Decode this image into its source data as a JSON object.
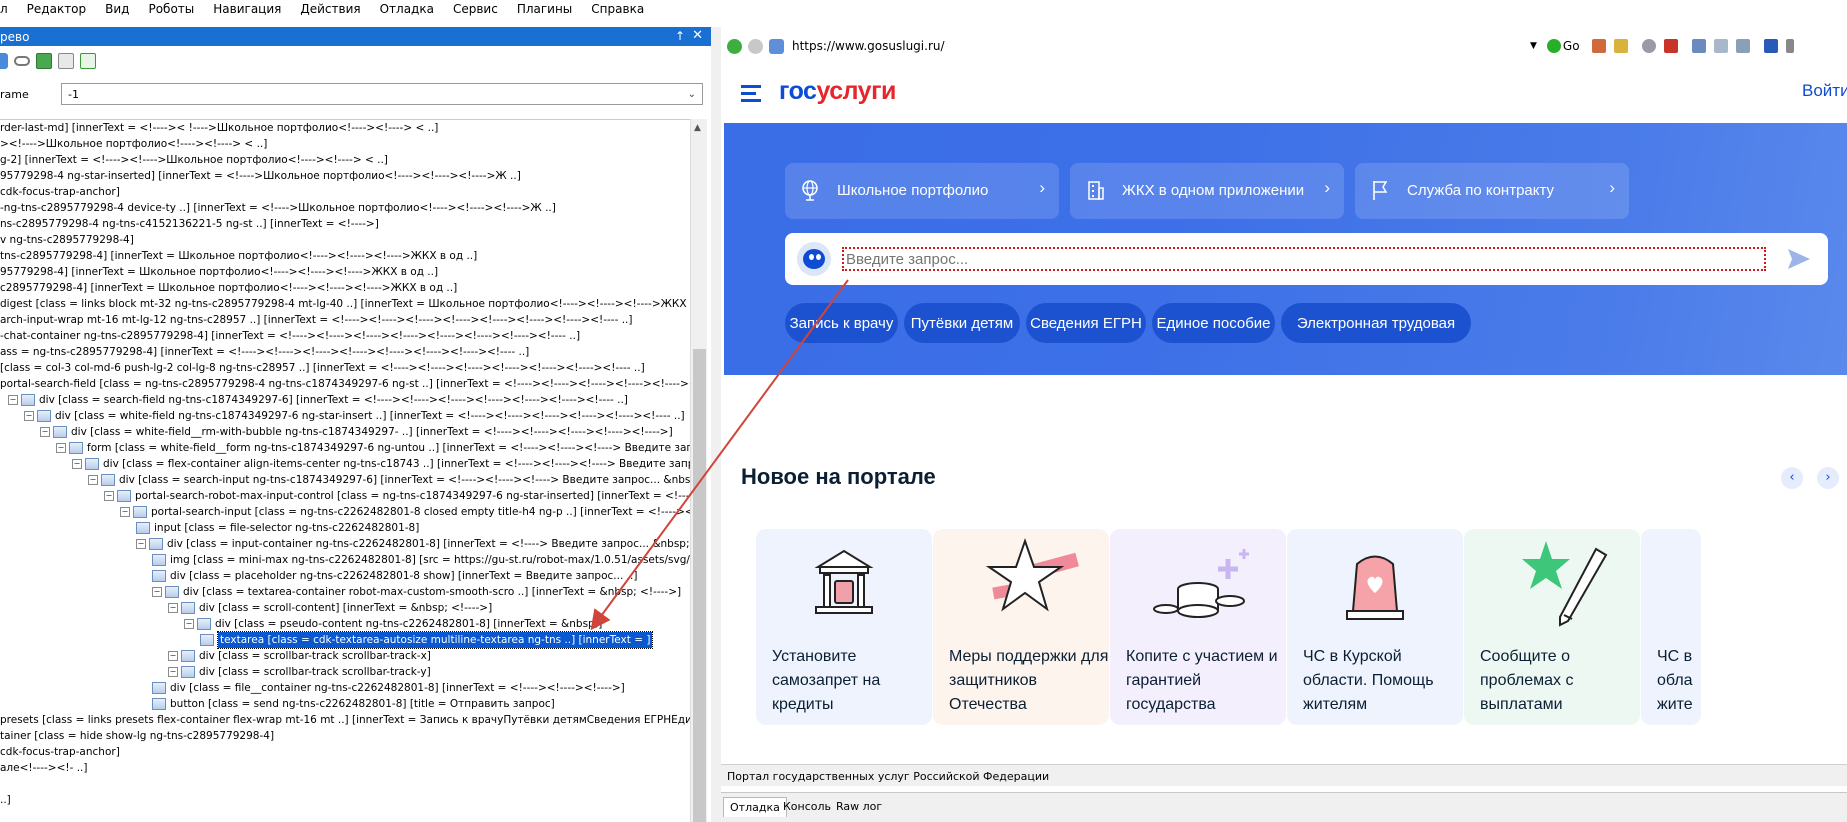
{
  "menu": [
    "л",
    "Редактор",
    "Вид",
    "Роботы",
    "Навигация",
    "Действия",
    "Отладка",
    "Сервис",
    "Плагины",
    "Справка"
  ],
  "panel": {
    "title": "рево",
    "pin": "↑",
    "close": "✕"
  },
  "frame": {
    "label": "rame",
    "value": "-1"
  },
  "tree": [
    {
      "indent": 0,
      "text": "rder-last-md] [innerText = <!---->< !---->Школьное портфолио<!----><!----> < ..]"
    },
    {
      "indent": 0,
      "text": "><!---->Школьное портфолио<!----><!----> < ..]"
    },
    {
      "indent": 0,
      "text": "g-2] [innerText = <!----><!---->Школьное портфолио<!----><!----> < ..]"
    },
    {
      "indent": 0,
      "text": "95779298-4 ng-star-inserted] [innerText = <!---->Школьное портфолио<!----><!----><!---->Ж ..]"
    },
    {
      "indent": 0,
      "text": " cdk-focus-trap-anchor]"
    },
    {
      "indent": 0,
      "text": "-ng-tns-c2895779298-4 device-ty ..] [innerText = <!---->Школьное портфолио<!----><!----><!---->Ж ..]"
    },
    {
      "indent": 0,
      "text": "ns-c2895779298-4 ng-tns-c4152136221-5 ng-st ..] [innerText = <!---->]"
    },
    {
      "indent": 0,
      "text": "v ng-tns-c2895779298-4]"
    },
    {
      "indent": 0,
      "text": "tns-c2895779298-4] [innerText = Школьное портфолио<!----><!----><!---->ЖКХ в од ..]"
    },
    {
      "indent": 0,
      "text": "95779298-4] [innerText = Школьное портфолио<!----><!----><!---->ЖКХ в од ..]"
    },
    {
      "indent": 0,
      "text": "c2895779298-4] [innerText = Школьное портфолио<!----><!----><!---->ЖКХ в од ..]"
    },
    {
      "indent": 0,
      "text": "digest [class = links block mt-32 ng-tns-c2895779298-4 mt-lg-40 ..] [innerText = Школьное портфолио<!----><!----><!---->ЖКХ в од ..]"
    },
    {
      "indent": 0,
      "text": "arch-input-wrap mt-16 mt-lg-12 ng-tns-c28957 ..] [innerText = <!----><!----><!----><!----><!----><!----><!----><!---- ..]"
    },
    {
      "indent": 0,
      "text": "-chat-container ng-tns-c2895779298-4] [innerText = <!----><!----><!----><!----><!----><!----><!----><!---- ..]"
    },
    {
      "indent": 0,
      "text": "ass = ng-tns-c2895779298-4] [innerText = <!----><!----><!----><!----><!----><!----><!----><!---- ..]"
    },
    {
      "indent": 0,
      "text": " [class = col-3 col-md-6 push-lg-2 col-lg-8 ng-tns-c28957 ..] [innerText = <!----><!----><!----><!----><!----><!----><!---- ..]"
    },
    {
      "indent": 0,
      "text": " portal-search-field [class = ng-tns-c2895779298-4 ng-tns-c1874349297-6 ng-st ..] [innerText = <!----><!----><!----><!----><!----><!----><!---->"
    },
    {
      "indent": 1,
      "text": "div [class = search-field ng-tns-c1874349297-6] [innerText = <!----><!----><!----><!----><!----><!----><!---- ..]"
    },
    {
      "indent": 2,
      "text": "div [class = white-field ng-tns-c1874349297-6 ng-star-insert ..] [innerText = <!----><!----><!----><!----><!----><!---- ..]"
    },
    {
      "indent": 3,
      "text": "div [class = white-field__rm-with-bubble ng-tns-c1874349297- ..] [innerText = <!----><!----><!----><!----><!---->]"
    },
    {
      "indent": 4,
      "text": "form [class = white-field__form ng-tns-c1874349297-6 ng-untou ..] [innerText = <!----><!----><!----> Введите запрос... &nbsp"
    },
    {
      "indent": 5,
      "text": "div [class = flex-container align-items-center ng-tns-c18743 ..] [innerText = <!----><!----><!----> Введите запрос... &nbsp;"
    },
    {
      "indent": 6,
      "text": "div [class = search-input ng-tns-c1874349297-6] [innerText = <!----><!----><!----> Введите запрос... &nbsp;   ..]"
    },
    {
      "indent": 7,
      "text": "portal-search-robot-max-input-control [class = ng-tns-c1874349297-6 ng-star-inserted] [innerText = <!----><!---->"
    },
    {
      "indent": 8,
      "text": "portal-search-input [class = ng-tns-c2262482801-8 closed empty title-h4 ng-p ..] [innerText = <!----><!---->"
    },
    {
      "indent": 9,
      "text": "input [class = file-selector ng-tns-c2262482801-8]"
    },
    {
      "indent": 9,
      "text": "div [class = input-container ng-tns-c2262482801-8] [innerText = <!----> Введите запрос... &nbsp;    <!---->"
    },
    {
      "indent": 10,
      "text": "img [class = mini-max ng-tns-c2262482801-8] [src = https://gu-st.ru/robot-max/1.0.51/assets/svg/ro ..] ["
    },
    {
      "indent": 10,
      "text": "div [class = placeholder ng-tns-c2262482801-8 show] [innerText =  Введите запрос... ..]"
    },
    {
      "indent": 10,
      "text": "div [class = textarea-container robot-max-custom-smooth-scro ..] [innerText = &nbsp;    <!---->]"
    },
    {
      "indent": 11,
      "text": "div [class = scroll-content] [innerText = &nbsp;    <!---->]"
    },
    {
      "indent": 12,
      "text": "div [class = pseudo-content ng-tns-c2262482801-8] [innerText = &nbsp;]"
    },
    {
      "indent": 13,
      "text": "textarea [class = cdk-textarea-autosize multiline-textarea ng-tns ..] [innerText =     ]",
      "selected": true
    },
    {
      "indent": 11,
      "text": "div [class = scrollbar-track scrollbar-track-x]"
    },
    {
      "indent": 11,
      "text": "div [class = scrollbar-track scrollbar-track-y]"
    },
    {
      "indent": 10,
      "text": "div [class = file__container ng-tns-c2262482801-8] [innerText = <!----><!----><!---->]"
    },
    {
      "indent": 10,
      "text": "button [class = send ng-tns-c2262482801-8] [title = Отправить запрос]"
    },
    {
      "indent": 0,
      "text": "presets [class = links presets flex-container flex-wrap mt-16 mt ..] [innerText = Запись к врачуПутёвки детямСведения ЕГРНЕдиное  ..]"
    },
    {
      "indent": 0,
      "text": "tainer [class = hide show-lg ng-tns-c2895779298-4]"
    },
    {
      "indent": 0,
      "text": " cdk-focus-trap-anchor]"
    },
    {
      "indent": 0,
      "text": "але<!----><!- ..]"
    },
    {
      "indent": 0,
      "text": ""
    },
    {
      "indent": 0,
      "text": "          ..]"
    }
  ],
  "browser": {
    "url": "https://www.gosuslugi.ru/",
    "go_label": "Go"
  },
  "site": {
    "logo_part1": "гос",
    "logo_part2": "услуги",
    "login": "Войти",
    "services": [
      {
        "label": "Школьное портфолио",
        "icon": "globe-icon"
      },
      {
        "label": "ЖКХ в одном приложении",
        "icon": "building-icon"
      },
      {
        "label": "Служба по контракту",
        "icon": "flag-icon"
      }
    ],
    "search_placeholder": "Введите запрос...",
    "presets": [
      "Запись к врачу",
      "Путёвки детям",
      "Сведения ЕГРН",
      "Единое пособие",
      "Электронная трудовая"
    ],
    "new_title": "Новое на портале",
    "cards": [
      {
        "text": "Установите самозапрет на кредиты",
        "bg": "#eef3fd"
      },
      {
        "text": "Меры поддержки для защитников Отечества",
        "bg": "#fdf4ee"
      },
      {
        "text": "Копите с участием и гарантией государства",
        "bg": "#f3effd"
      },
      {
        "text": "ЧС в Курской области. Помощь жителям",
        "bg": "#eef3fd"
      },
      {
        "text": "Сообщите о проблемах с выплатами",
        "bg": "#eef8f2"
      },
      {
        "text": "ЧС в обла жите",
        "bg": "#eef3fd"
      }
    ]
  },
  "statusbar": {
    "text": "Портал государственных услуг Российской Федерации"
  },
  "tabs": [
    "Отладка",
    "Консоль",
    "Raw лог"
  ],
  "colors": {
    "brand_blue": "#0d4cd3",
    "brand_red": "#e5262b",
    "selection": "#0a58d0",
    "annotation_arrow": "#d0453a"
  }
}
